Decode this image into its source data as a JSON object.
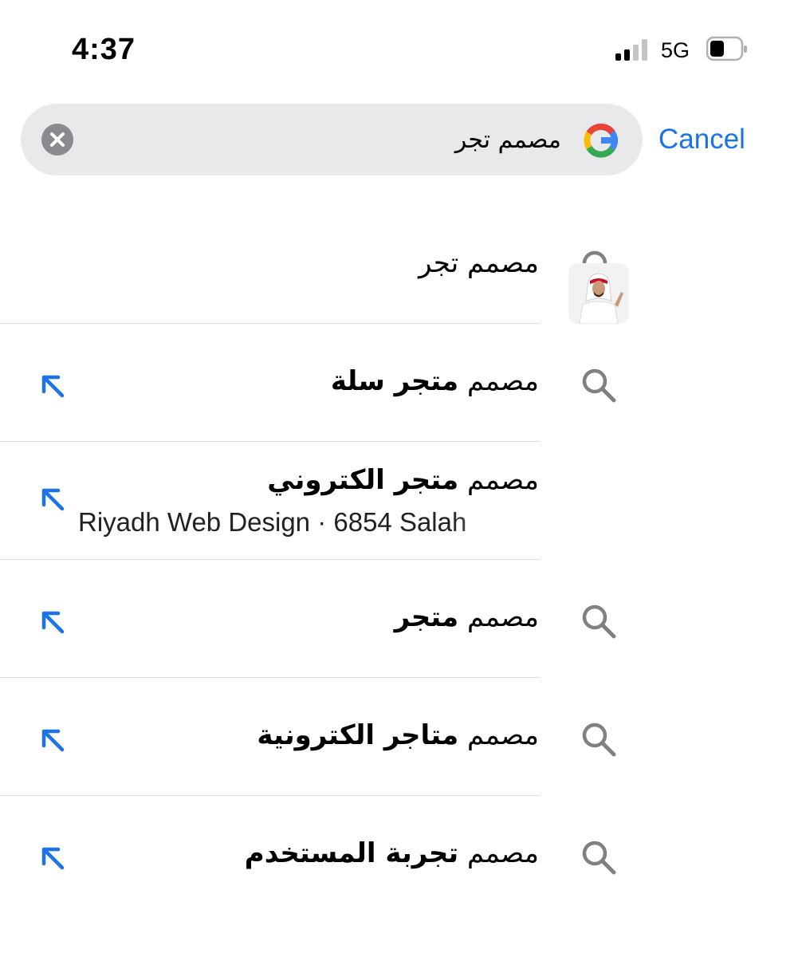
{
  "status_bar": {
    "time": "4:37",
    "network": "5G",
    "signal_bars_active": 2,
    "signal_bars_total": 4
  },
  "search": {
    "query": "مصمم تجر",
    "engine_icon": "google-g-icon",
    "clear_icon": "clear-circle-icon",
    "cancel_label": "Cancel"
  },
  "colors": {
    "accent": "#1a73e8",
    "search_bg": "#e9e9eb",
    "icon_gray": "#808080",
    "divider": "#dcdcdc"
  },
  "suggestions": [
    {
      "prefix": "مصمم تجر",
      "completion": "",
      "icon": "search-icon",
      "has_fill_arrow": false
    },
    {
      "prefix": "مصمم",
      "completion": "متجر سلة",
      "icon": "search-icon",
      "has_fill_arrow": true
    },
    {
      "prefix": "مصمم",
      "completion": "متجر الكتروني",
      "subtitle": "Riyadh Web Design · 6854 Salah",
      "icon": "business-thumbnail",
      "has_fill_arrow": true
    },
    {
      "prefix": "مصمم",
      "completion": "متجر",
      "icon": "search-icon",
      "has_fill_arrow": true
    },
    {
      "prefix": "مصمم",
      "completion": "متاجر الكترونية",
      "icon": "search-icon",
      "has_fill_arrow": true
    },
    {
      "prefix": "مصمم",
      "completion": "تجربة المستخدم",
      "icon": "search-icon",
      "has_fill_arrow": true
    }
  ]
}
